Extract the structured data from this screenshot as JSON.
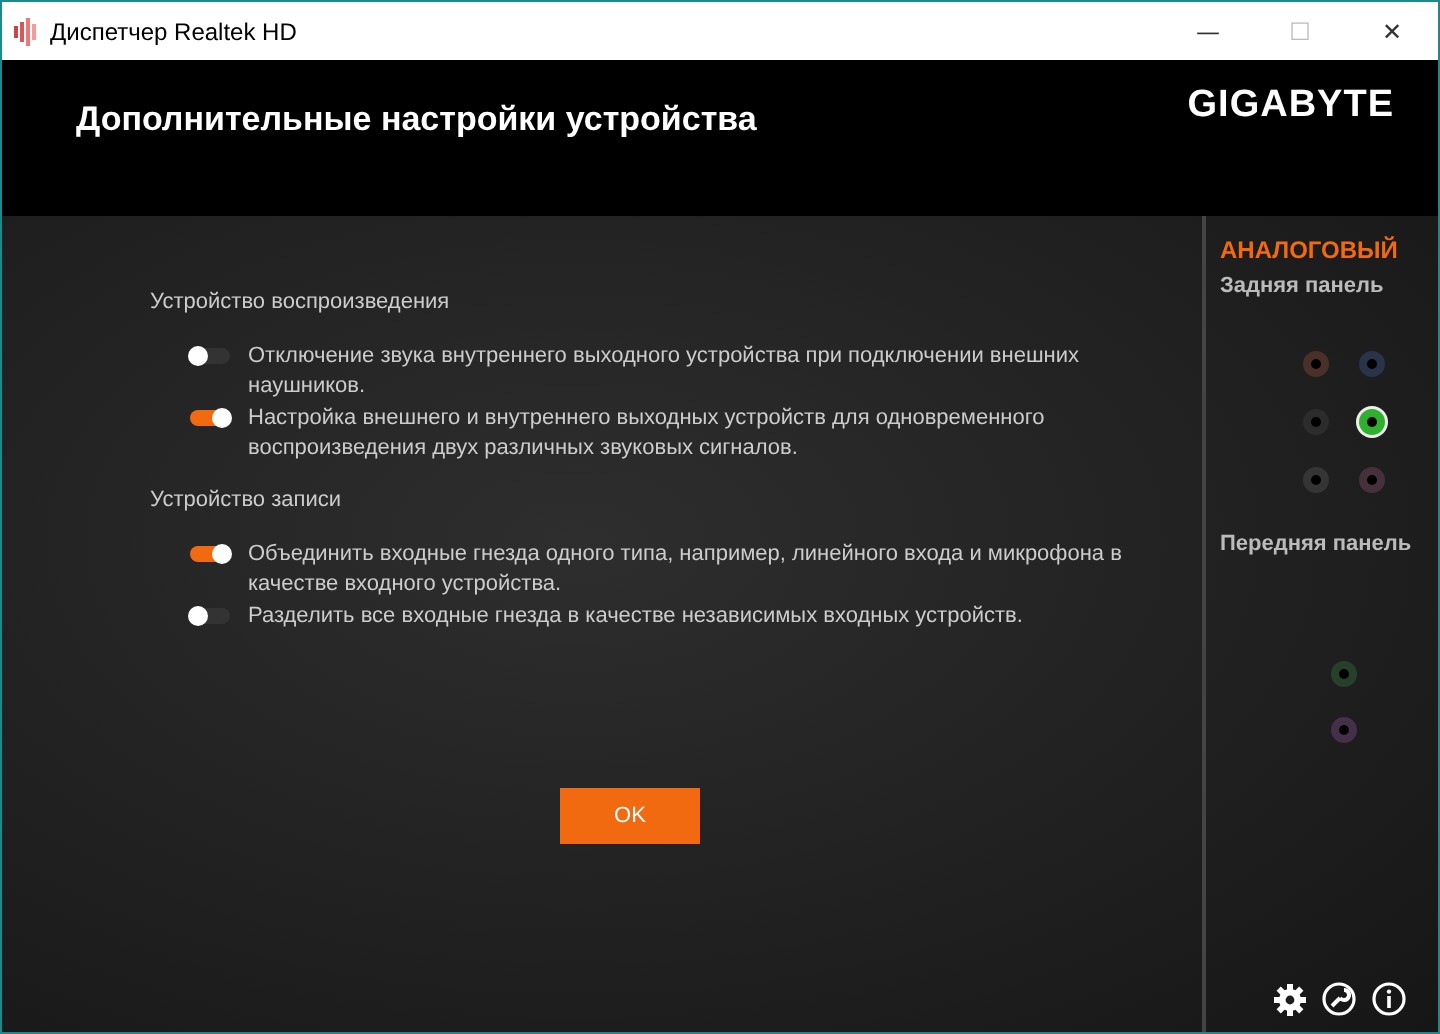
{
  "window": {
    "title": "Диспетчер Realtek HD",
    "controls": [
      "—",
      "☐",
      "✕"
    ]
  },
  "header": {
    "title": "Дополнительные настройки устройства",
    "brand": "GIGABYTE"
  },
  "sections": [
    {
      "heading": "Устройство воспроизведения",
      "options": [
        {
          "label": "Отключение звука внутреннего выходного устройства при подключении внешних наушников.",
          "on": false
        },
        {
          "label": "Настройка внешнего и внутреннего выходных устройств для одновременного воспроизведения двух различных звуковых сигналов.",
          "on": true
        }
      ]
    },
    {
      "heading": "Устройство записи",
      "options": [
        {
          "label": "Объединить входные гнезда одного типа, например, линейного входа и микрофона в качестве входного устройства.",
          "on": true
        },
        {
          "label": "Разделить все входные гнезда в качестве независимых входных устройств.",
          "on": false
        }
      ]
    }
  ],
  "ok_button": "OK",
  "side_panel": {
    "title": "АНАЛОГОВЫЙ",
    "rear": {
      "label": "Задняя панель",
      "jacks": [
        {
          "color": "#4a3028",
          "active": false
        },
        {
          "color": "#28344a",
          "active": false
        },
        {
          "color": "#2c2c2c",
          "active": false
        },
        {
          "color": "#2fb02f",
          "active": true
        },
        {
          "color": "#353535",
          "active": false
        },
        {
          "color": "#46303c",
          "active": false
        }
      ]
    },
    "front": {
      "label": "Передняя панель",
      "jacks": [
        {
          "color": "#27402a",
          "active": false
        },
        {
          "color": "#45304a",
          "active": false
        }
      ]
    }
  }
}
